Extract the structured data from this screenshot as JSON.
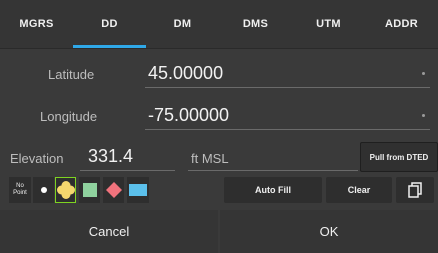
{
  "tabs": [
    {
      "label": "MGRS",
      "active": false
    },
    {
      "label": "DD",
      "active": true
    },
    {
      "label": "DM",
      "active": false
    },
    {
      "label": "DMS",
      "active": false
    },
    {
      "label": "UTM",
      "active": false
    },
    {
      "label": "ADDR",
      "active": false
    }
  ],
  "latitude": {
    "label": "Latitude",
    "value": "45.00000"
  },
  "longitude": {
    "label": "Longitude",
    "value": "-75.00000"
  },
  "elevation": {
    "label": "Elevation",
    "value": "331.4",
    "unit": "ft MSL"
  },
  "buttons": {
    "pull_from_dted": "Pull from DTED",
    "no_point_line1": "No",
    "no_point_line2": "Point",
    "auto_fill": "Auto Fill",
    "clear": "Clear",
    "cancel": "Cancel",
    "ok": "OK"
  },
  "shapes": [
    {
      "name": "dot",
      "color": "#ffffff"
    },
    {
      "name": "circle-cluster",
      "color": "#f5d76e",
      "selected": true
    },
    {
      "name": "square",
      "color": "#8fd19e"
    },
    {
      "name": "diamond",
      "color": "#f0727c"
    },
    {
      "name": "rectangle",
      "color": "#5bc0eb"
    }
  ],
  "accent_color": "#2fa8e8",
  "selection_color": "#7ed321"
}
